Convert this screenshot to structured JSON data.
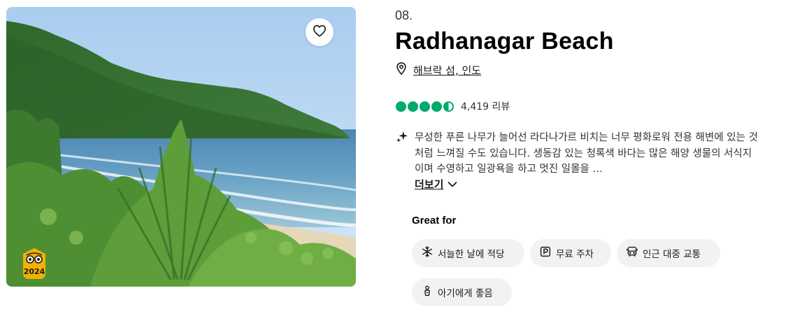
{
  "card": {
    "rank": "08.",
    "title": "Radhanagar Beach",
    "location": "해브락 섬, 인도",
    "rating": {
      "value": 4.5,
      "bubbles_full": 4,
      "bubbles_half": 1,
      "review_count": "4,419 리뷰"
    },
    "description": "무성한 푸른 나무가 늘어선 라다나가르 비치는 너무 평화로워 전용 해변에 있는 것처럼 느껴질 수도 있습니다. 생동감 있는 청록색 바다는 많은 해양 생물의 서식지이며 수영하고 일광욕을 하고 멋진 일몰을 …",
    "more_label": "더보기",
    "award_year": "2024",
    "great_for": {
      "heading": "Great for",
      "tags": [
        {
          "label": "서늘한 날에 적당",
          "icon": "snowflake-icon"
        },
        {
          "label": "무료 주차",
          "icon": "parking-icon"
        },
        {
          "label": "인근 대중 교통",
          "icon": "bus-icon"
        },
        {
          "label": "아기에게 좋음",
          "icon": "baby-icon"
        }
      ]
    },
    "icons": {
      "save": "heart-icon",
      "location": "map-pin-icon",
      "ai_summary": "sparkle-icon",
      "more": "chevron-down-icon",
      "award": "travelers-choice-badge-icon"
    }
  },
  "colors": {
    "rating_green": "#00aa6c",
    "chip_background": "#f2f2f0",
    "award_yellow": "#f2b203",
    "text": "#1a1a1a"
  }
}
